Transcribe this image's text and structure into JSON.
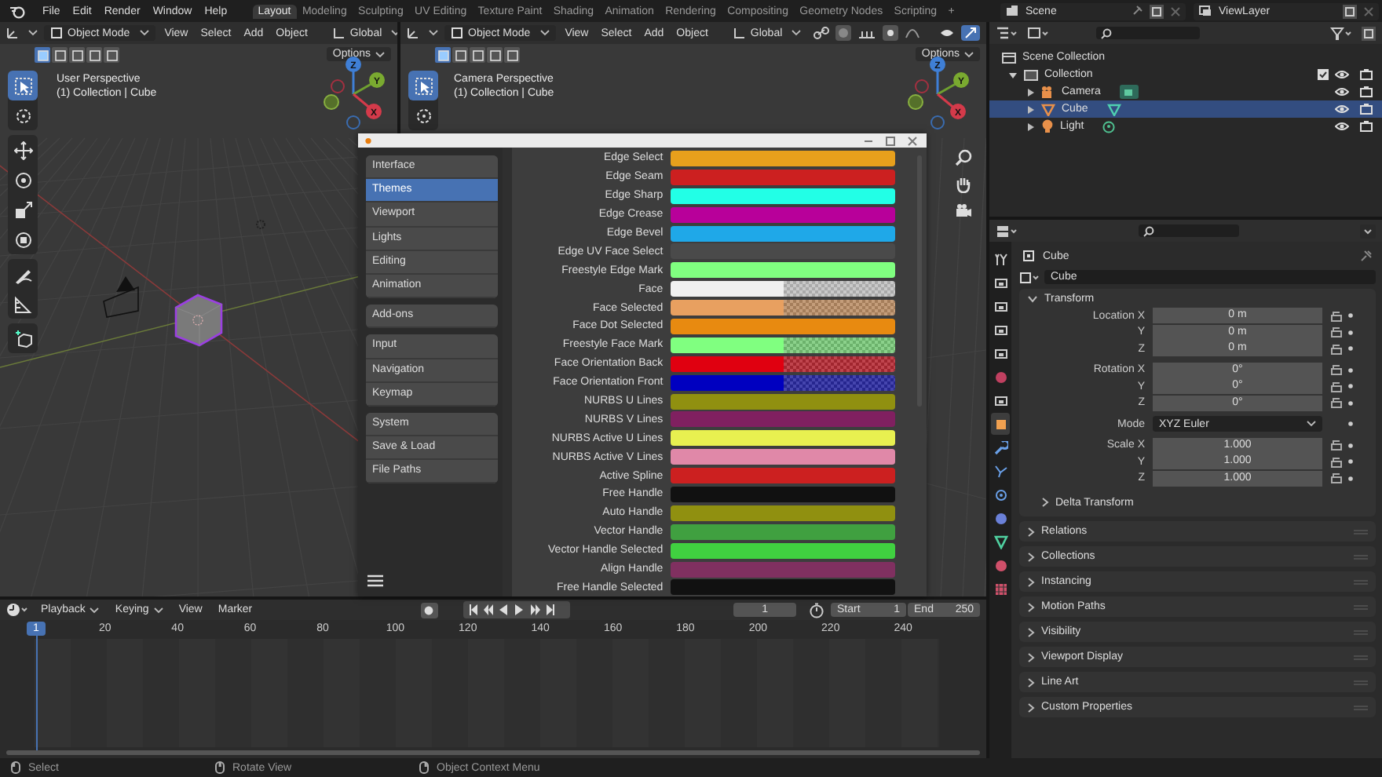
{
  "menu": [
    "File",
    "Edit",
    "Render",
    "Window",
    "Help"
  ],
  "workspaces": [
    {
      "label": "Layout",
      "selected": true
    },
    {
      "label": "Modeling",
      "selected": false
    },
    {
      "label": "Sculpting",
      "selected": false
    },
    {
      "label": "UV Editing",
      "selected": false
    },
    {
      "label": "Texture Paint",
      "selected": false
    },
    {
      "label": "Shading",
      "selected": false
    },
    {
      "label": "Animation",
      "selected": false
    },
    {
      "label": "Rendering",
      "selected": false
    },
    {
      "label": "Compositing",
      "selected": false
    },
    {
      "label": "Geometry Nodes",
      "selected": false
    },
    {
      "label": "Scripting",
      "selected": false
    }
  ],
  "add_workspace": "+",
  "scene": "Scene",
  "view_layer": "ViewLayer",
  "viewports": [
    {
      "mode": "Object Mode",
      "menus": [
        "View",
        "Select",
        "Add",
        "Object"
      ],
      "orientation": "Global",
      "options": "Options",
      "title": "User Perspective",
      "subtitle": "(1) Collection | Cube",
      "axes": [
        "Z",
        "Y",
        "X"
      ]
    },
    {
      "mode": "Object Mode",
      "menus": [
        "View",
        "Select",
        "Add",
        "Object"
      ],
      "orientation": "Global",
      "options": "Options",
      "title": "Camera Perspective",
      "subtitle": "(1) Collection | Cube",
      "axes": [
        "Z",
        "Y",
        "X"
      ]
    }
  ],
  "preferences": {
    "sections": [
      [
        {
          "label": "Interface",
          "selected": false
        },
        {
          "label": "Themes",
          "selected": true
        },
        {
          "label": "Viewport",
          "selected": false
        },
        {
          "label": "Lights",
          "selected": false
        },
        {
          "label": "Editing",
          "selected": false
        },
        {
          "label": "Animation",
          "selected": false
        }
      ],
      [
        {
          "label": "Add-ons",
          "selected": false
        }
      ],
      [
        {
          "label": "Input",
          "selected": false
        },
        {
          "label": "Navigation",
          "selected": false
        },
        {
          "label": "Keymap",
          "selected": false
        }
      ],
      [
        {
          "label": "System",
          "selected": false
        },
        {
          "label": "Save & Load",
          "selected": false
        },
        {
          "label": "File Paths",
          "selected": false
        }
      ]
    ],
    "theme_rows": [
      {
        "label": "Edge Select",
        "kind": "solid",
        "color": "#e8a01c"
      },
      {
        "label": "Edge Seam",
        "kind": "solid",
        "color": "#cc2020"
      },
      {
        "label": "Edge Sharp",
        "kind": "solid",
        "color": "#22ffe6"
      },
      {
        "label": "Edge Crease",
        "kind": "solid",
        "color": "#b8009a"
      },
      {
        "label": "Edge Bevel",
        "kind": "solid",
        "color": "#1fa8e8"
      },
      {
        "label": "Edge UV Face Select",
        "kind": "solid",
        "color": "#4a4a4a"
      },
      {
        "label": "Freestyle Edge Mark",
        "kind": "solid",
        "color": "#80ff80"
      },
      {
        "label": "Face",
        "kind": "alpha",
        "color": "#f0f0f0"
      },
      {
        "label": "Face Selected",
        "kind": "alpha",
        "color": "#e8a060"
      },
      {
        "label": "Face Dot Selected",
        "kind": "solid",
        "color": "#e88a10"
      },
      {
        "label": "Freestyle Face Mark",
        "kind": "alpha",
        "color": "#80ff80"
      },
      {
        "label": "Face Orientation Back",
        "kind": "alpha",
        "color": "#e00010"
      },
      {
        "label": "Face Orientation Front",
        "kind": "alpha",
        "color": "#0000c0"
      },
      {
        "label": "NURBS U Lines",
        "kind": "solid",
        "color": "#909010"
      },
      {
        "label": "NURBS V Lines",
        "kind": "solid",
        "color": "#802060"
      },
      {
        "label": "NURBS Active U Lines",
        "kind": "solid",
        "color": "#e8f050"
      },
      {
        "label": "NURBS Active V Lines",
        "kind": "solid",
        "color": "#e088a8"
      },
      {
        "label": "Active Spline",
        "kind": "solid",
        "color": "#cc2020"
      },
      {
        "label": "Free Handle",
        "kind": "solid",
        "color": "#111111"
      },
      {
        "label": "Auto Handle",
        "kind": "solid",
        "color": "#909010"
      },
      {
        "label": "Vector Handle",
        "kind": "solid",
        "color": "#40a040"
      },
      {
        "label": "Vector Handle Selected",
        "kind": "solid",
        "color": "#40d040"
      },
      {
        "label": "Align Handle",
        "kind": "solid",
        "color": "#803060"
      },
      {
        "label": "Free Handle Selected",
        "kind": "solid",
        "color": "#111111"
      }
    ]
  },
  "outliner": {
    "root": "Scene Collection",
    "children": [
      {
        "label": "Collection",
        "expanded": true,
        "checked": true,
        "children": [
          {
            "label": "Camera",
            "kind": "camera",
            "selected": false
          },
          {
            "label": "Cube",
            "kind": "mesh",
            "selected": true
          },
          {
            "label": "Light",
            "kind": "light",
            "selected": false
          }
        ]
      }
    ]
  },
  "properties": {
    "object": "Cube",
    "name_field": "Cube",
    "panel": "Transform",
    "expanded": true,
    "rows": [
      {
        "kind": "field",
        "label": "Location X",
        "value": "0 m"
      },
      {
        "kind": "field",
        "label": "Y",
        "value": "0 m"
      },
      {
        "kind": "field",
        "label": "Z",
        "value": "0 m"
      },
      {
        "kind": "field",
        "label": "Rotation X",
        "value": "0°"
      },
      {
        "kind": "field",
        "label": "Y",
        "value": "0°"
      },
      {
        "kind": "field",
        "label": "Z",
        "value": "0°"
      },
      {
        "kind": "dropdown",
        "label": "Mode",
        "value": "XYZ Euler"
      },
      {
        "kind": "field",
        "label": "Scale X",
        "value": "1.000"
      },
      {
        "kind": "field",
        "label": "Y",
        "value": "1.000"
      },
      {
        "kind": "field",
        "label": "Z",
        "value": "1.000"
      }
    ],
    "subpanel": "Delta Transform",
    "panels": [
      "Relations",
      "Collections",
      "Instancing",
      "Motion Paths",
      "Visibility",
      "Viewport Display",
      "Line Art",
      "Custom Properties"
    ]
  },
  "timeline": {
    "menus": [
      {
        "label": "Playback",
        "dropdown": true
      },
      {
        "label": "Keying",
        "dropdown": true
      },
      {
        "label": "View",
        "dropdown": false
      },
      {
        "label": "Marker",
        "dropdown": false
      }
    ],
    "current_frame": "1",
    "start_label": "Start",
    "start": "1",
    "end_label": "End",
    "end": "250",
    "ticks": [
      "1",
      "20",
      "40",
      "60",
      "80",
      "100",
      "120",
      "140",
      "160",
      "180",
      "200",
      "220",
      "240"
    ]
  },
  "status_bar": [
    "Select",
    "Rotate View",
    "Object Context Menu"
  ]
}
